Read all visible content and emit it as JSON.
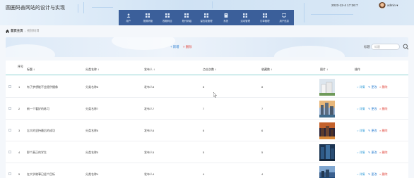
{
  "header": {
    "title": "圆圈码善网站的设计与实现",
    "datetime": "2023-12-4 17:26:7",
    "user": "admin ▾",
    "nav": [
      {
        "label": "用户",
        "icon": "user-icon"
      },
      {
        "label": "视频码管",
        "icon": "grid-icon"
      },
      {
        "label": "视频码目",
        "icon": "grid-icon"
      },
      {
        "label": "程代码级",
        "icon": "grid-icon"
      },
      {
        "label": "留言板管理",
        "icon": "grid-icon"
      },
      {
        "label": "系统",
        "icon": "book-icon"
      },
      {
        "label": "活动管理",
        "icon": "grid-icon"
      },
      {
        "label": "订单管理",
        "icon": "grid-icon"
      },
      {
        "label": "用户信息",
        "icon": "screen-icon"
      }
    ]
  },
  "breadcrumb": {
    "home": "首页主页",
    "sep": "›",
    "current": "视频码目"
  },
  "toolbar": {
    "add": "+ 新增",
    "delete": "× 删除",
    "search_label": "标题",
    "search_placeholder": "标题"
  },
  "table": {
    "headers": [
      "序号",
      "标题 ↕",
      "分类名称 ↕",
      "发布人 ↕",
      "点击次数 ↕",
      "收藏数 ↕",
      "图片 ↕",
      "操作"
    ],
    "actions": {
      "detail": "○ 详情",
      "edit": "✎ 更改",
      "delete": "× 删除"
    },
    "rows": [
      {
        "index": "1",
        "title": "有了梦想能不会提供摄像",
        "category": "分类名称8",
        "publisher": "发布人8",
        "clicks": "8",
        "favorites": "8",
        "image": "thumb-modern-buildings"
      },
      {
        "index": "2",
        "title": "新一个看好的练习",
        "category": "分类名称7",
        "publisher": "发布人7",
        "clicks": "7",
        "favorites": "7",
        "image": "thumb-city-sunset"
      },
      {
        "index": "3",
        "title": "忘大的坚持最后的成功",
        "category": "分类名称6",
        "publisher": "发布人6",
        "clicks": "6",
        "favorites": "6",
        "image": "thumb-night-city"
      },
      {
        "index": "4",
        "title": "那个真正的学生",
        "category": "分类名称5",
        "publisher": "发布人5",
        "clicks": "5",
        "favorites": "5",
        "image": "thumb-skyscrapers"
      },
      {
        "index": "5",
        "title": "在大学故事已经个目标",
        "category": "分类名称4",
        "publisher": "发布人4",
        "clicks": "4",
        "favorites": "4",
        "image": "thumb-harbor-dusk"
      }
    ]
  },
  "colors": {
    "nav_bg": "#3b5f9a",
    "accent_teal": "#8fd3d3",
    "link_blue": "#2d7fd1",
    "danger_red": "#e0463c"
  }
}
